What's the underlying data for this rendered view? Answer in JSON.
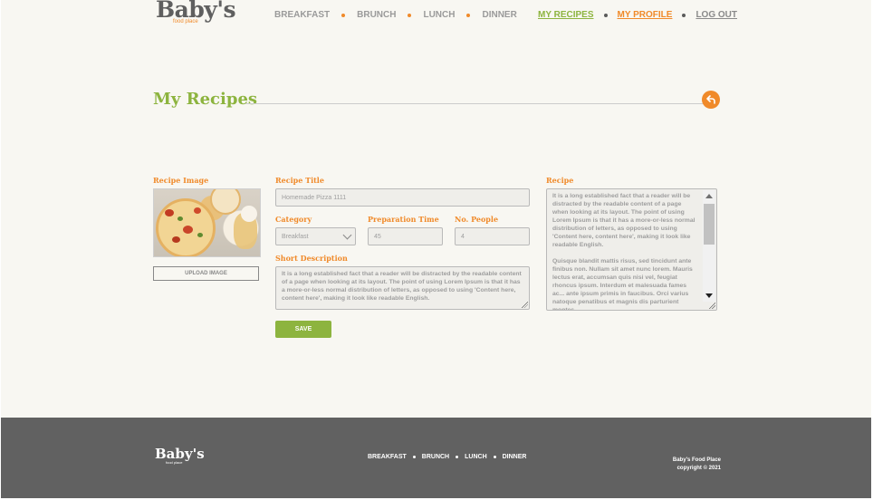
{
  "brand": {
    "name": "Baby's",
    "tagline": "food place"
  },
  "nav": {
    "left": [
      {
        "label": "BREAKFAST"
      },
      {
        "label": "BRUNCH"
      },
      {
        "label": "LUNCH"
      },
      {
        "label": "DINNER"
      }
    ],
    "right": [
      {
        "label": "MY RECIPES"
      },
      {
        "label": "MY PROFILE"
      },
      {
        "label": "LOG OUT"
      }
    ]
  },
  "page": {
    "title": "My Recipes",
    "back_icon": "back-arrow-icon"
  },
  "form": {
    "recipe_image_label": "Recipe Image",
    "upload_button": "UPLOAD IMAGE",
    "title_label": "Recipe Title",
    "title_value": "Homemade Pizza 1111",
    "category_label": "Category",
    "category_value": "Breakfast",
    "prep_time_label": "Preparation Time",
    "prep_time_value": "45",
    "people_label": "No. People",
    "people_value": "4",
    "short_desc_label": "Short Description",
    "short_desc_value": "It is a long established fact that a reader will be distracted by the readable content of a page when looking at its layout. The point of using Lorem Ipsum is that it has a more-or-less normal distribution of letters, as opposed to using 'Content here, content here', making it look like readable English.",
    "recipe_label": "Recipe",
    "recipe_value_p1": "It is a long established fact that a reader will be distracted by the readable content of a page when looking at its layout. The point of using Lorem Ipsum is that it has a more-or-less normal distribution of letters, as opposed to using 'Content here, content here', making it look like readable English.",
    "recipe_value_p2": "Quisque blandit mattis risus, sed tincidunt ante finibus non. Nullam sit amet nunc lorem. Mauris lectus erat, accumsan quis nisi vel, feugiat rhoncus ipsum. Interdum et malesuada fames ac... ante ipsum primis in faucibus. Orci varius natoque penatibus et magnis dis parturient montes,",
    "save_button": "SAVE"
  },
  "footer": {
    "nav": [
      {
        "label": "BREAKFAST"
      },
      {
        "label": "BRUNCH"
      },
      {
        "label": "LUNCH"
      },
      {
        "label": "DINNER"
      }
    ],
    "company": "Baby's Food Place",
    "copyright": "copyright © 2021"
  },
  "colors": {
    "accent_green": "#8db43f",
    "accent_orange": "#f08a2a",
    "background": "#f8f7f2",
    "footer": "#616161"
  }
}
